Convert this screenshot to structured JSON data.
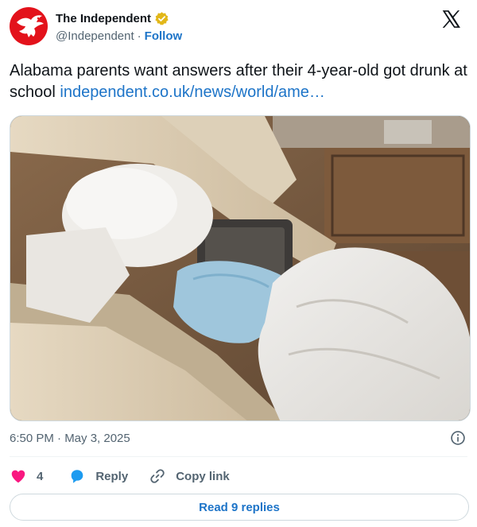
{
  "account": {
    "display_name": "The Independent",
    "handle": "@Independent",
    "separator": "·",
    "follow_label": "Follow"
  },
  "tweet": {
    "text": "Alabama parents want answers after their 4-year-old got drunk at school",
    "link_text": "independent.co.uk/news/world/ame…"
  },
  "meta": {
    "timestamp": "6:50 PM · May 3, 2025"
  },
  "actions": {
    "like_count": "4",
    "reply_label": "Reply",
    "copy_link_label": "Copy link"
  },
  "replies": {
    "read_label": "Read 9 replies"
  },
  "colors": {
    "brand_red": "#e3121b",
    "link_blue": "#1d74c8",
    "like_pink": "#f91880",
    "verified_gold": "#e2b719",
    "muted_text": "#536471"
  },
  "icons": {
    "verified": "verified-badge-icon",
    "platform": "x-logo-icon",
    "info": "info-icon",
    "like": "heart-icon",
    "reply": "speech-bubble-icon",
    "copy": "link-icon"
  }
}
